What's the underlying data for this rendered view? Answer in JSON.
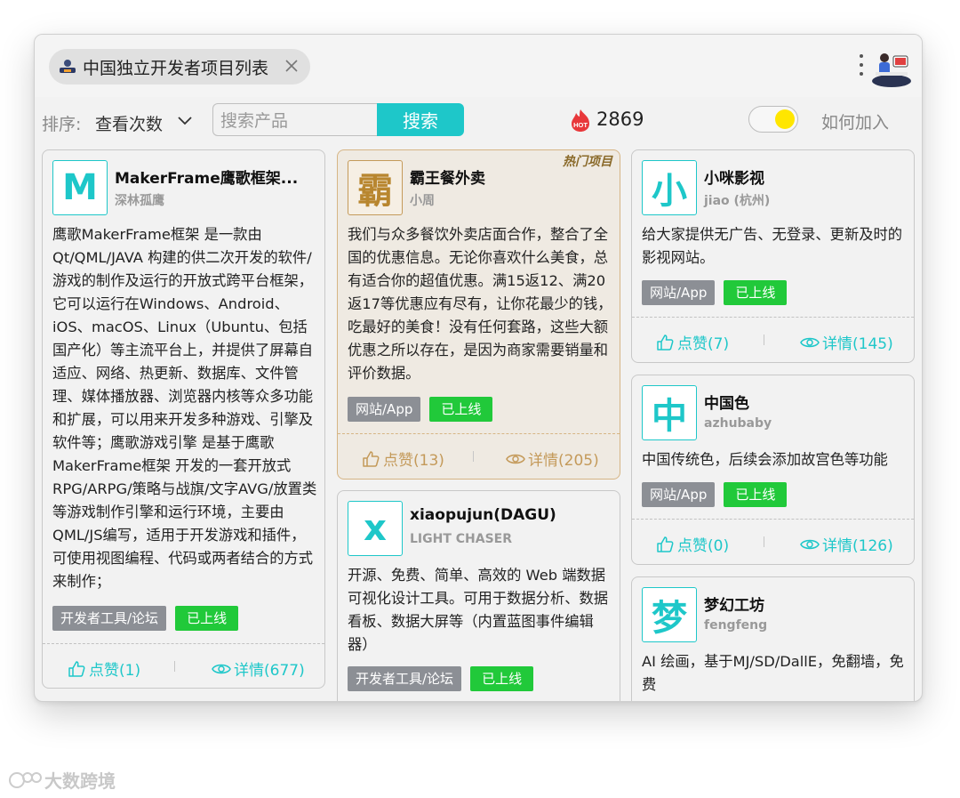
{
  "tab": {
    "title": "中国独立开发者项目列表"
  },
  "toolbar": {
    "sort_label": "排序:",
    "sort_value": "查看次数",
    "search_placeholder": "搜索产品",
    "search_button": "搜索",
    "hot_badge": "HOT",
    "hot_count": "2869",
    "join_link": "如何加入"
  },
  "cards": [
    {
      "logo": "M",
      "name": "MakerFrame鹰歌框架...",
      "author": "深林孤鹰",
      "desc": "鹰歌MakerFrame框架 是一款由 Qt/QML/JAVA 构建的供二次开发的软件/游戏的制作及运行的开放式跨平台框架，它可以运行在Windows、Android、iOS、macOS、Linux（Ubuntu、包括国产化）等主流平台上，并提供了屏幕自适应、网络、热更新、数据库、文件管理、媒体播放器、浏览器内核等众多功能和扩展，可以用来开发多种游戏、引擎及软件等；鹰歌游戏引擎 是基于鹰歌MakerFrame框架 开发的一套开放式 RPG/ARPG/策略与战旗/文字AVG/放置类 等游戏制作引擎和运行环境，主要由QML/JS编写，适用于开发游戏和插件，可使用视图编程、代码或两者结合的方式来制作；",
      "category": "开发者工具/论坛",
      "status": "已上线",
      "likes": "点赞(1)",
      "details": "详情(677)"
    },
    {
      "logo": "霸",
      "name": "霸王餐外卖",
      "author": "小周",
      "ribbon": "热门项目",
      "desc": "我们与众多餐饮外卖店面合作，整合了全国的优惠信息。无论你喜欢什么美食，总有适合你的超值优惠。满15返12、满20返17等优惠应有尽有，让你花最少的钱，吃最好的美食！没有任何套路，这些大额优惠之所以存在，是因为商家需要销量和评价数据。",
      "category": "网站/App",
      "status": "已上线",
      "likes": "点赞(13)",
      "details": "详情(205)"
    },
    {
      "logo": "x",
      "name": "xiaopujun(DAGU)",
      "author": "LIGHT CHASER",
      "desc": "开源、免费、简单、高效的 Web 端数据可视化设计工具。可用于数据分析、数据看板、数据大屏等（内置蓝图事件编辑器）",
      "category": "开发者工具/论坛",
      "status": "已上线"
    },
    {
      "logo": "小",
      "name": "小咪影视",
      "author": "jiao (杭州)",
      "desc": "给大家提供无广告、无登录、更新及时的影视网站。",
      "category": "网站/App",
      "status": "已上线",
      "likes": "点赞(7)",
      "details": "详情(145)"
    },
    {
      "logo": "中",
      "name": "中国色",
      "author": "azhubaby",
      "desc": "中国传统色，后续会添加故宫色等功能",
      "category": "网站/App",
      "status": "已上线",
      "likes": "点赞(0)",
      "details": "详情(126)"
    },
    {
      "logo": "梦",
      "name": "梦幻工坊",
      "author": "fengfeng",
      "desc": "AI 绘画，基于MJ/SD/DallE，免翻墙，免费"
    }
  ],
  "watermark": "大数跨境"
}
